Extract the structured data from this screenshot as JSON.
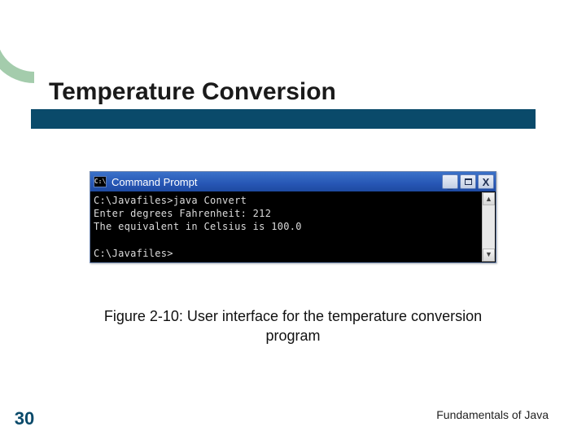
{
  "slide": {
    "title": "Temperature Conversion",
    "caption": "Figure 2-10: User interface for the temperature conversion program",
    "page_number": "30",
    "footer": "Fundamentals of Java"
  },
  "cmd": {
    "window_title": "Command Prompt",
    "icon_label": "C:\\",
    "lines": [
      "C:\\Javafiles>java Convert",
      "Enter degrees Fahrenheit: 212",
      "The equivalent in Celsius is 100.0",
      "",
      "C:\\Javafiles>"
    ],
    "buttons": {
      "min": "_",
      "close": "X"
    }
  }
}
